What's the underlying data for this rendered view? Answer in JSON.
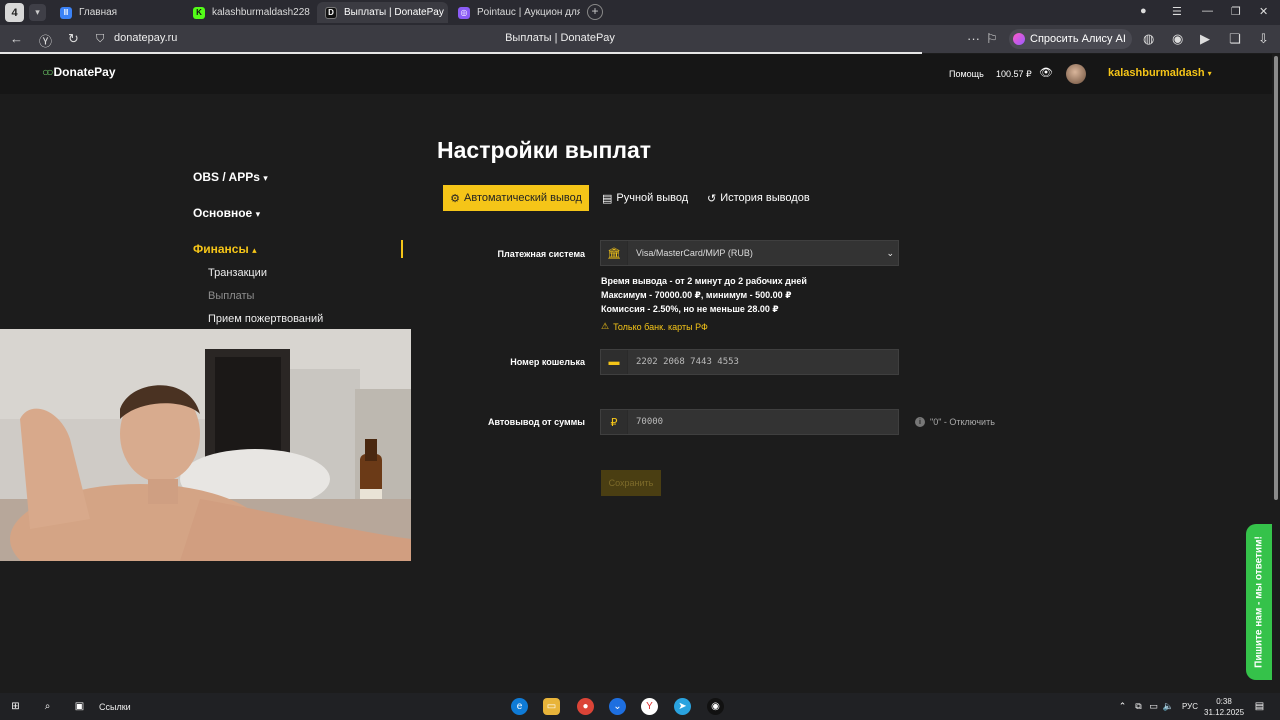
{
  "browser": {
    "tab_count": "4",
    "tabs": [
      {
        "title": "Главная",
        "favicon": "pause-icon",
        "color": "#3b82f6",
        "glyph": "II"
      },
      {
        "title": "kalashburmaldash228 Stre",
        "favicon": "kick-icon",
        "color": "#53fc18",
        "glyph": "K"
      },
      {
        "title": "Выплаты | DonatePay",
        "favicon": "donatepay-icon",
        "color": "#2b2b2b",
        "glyph": "D:"
      },
      {
        "title": "Pointauc | Аукцион для ст",
        "favicon": "pointauc-icon",
        "color": "#8b5cf6",
        "glyph": "◎"
      }
    ],
    "url": "donatepay.ru",
    "page_title": "Выплаты | DonatePay",
    "alice_label": "Спросить Алису AI"
  },
  "site": {
    "logo": "DonatePay",
    "help": "Помощь",
    "balance": "100.57 ₽",
    "username": "kalashburmaldash"
  },
  "sidebar": {
    "sections": [
      {
        "label": "OBS / APPs",
        "arrow": "▾"
      },
      {
        "label": "Основное",
        "arrow": "▾"
      },
      {
        "label": "Финансы",
        "arrow": "▴"
      }
    ],
    "finance_items": [
      {
        "label": "Транзакции"
      },
      {
        "label": "Выплаты"
      },
      {
        "label": "Прием пожертвований"
      }
    ]
  },
  "main": {
    "title": "Настройки выплат",
    "tabs": [
      {
        "label": "Автоматический вывод",
        "icon": "gear-icon"
      },
      {
        "label": "Ручной вывод",
        "icon": "database-icon"
      },
      {
        "label": "История выводов",
        "icon": "history-icon"
      }
    ],
    "payment_system": {
      "label": "Платежная система",
      "value": "Visa/MasterCard/МИР (RUB)"
    },
    "info_lines": [
      "Время вывода - от 2 минут до 2 рабочих дней",
      "Максимум  -  70000.00 ₽, минимум  -  500.00 ₽",
      "Комиссия  -  2.50%, но не меньше 28.00 ₽"
    ],
    "warning": "Только банк. карты РФ",
    "wallet": {
      "label": "Номер кошелька",
      "value": "2202 2068 7443 4553"
    },
    "auto_withdraw": {
      "label": "Автовывод от суммы",
      "value": "70000",
      "hint": "\"0\" - Отключить"
    },
    "save_label": "Сохранить"
  },
  "chat_widget": "Пишите нам - мы ответим!",
  "taskbar": {
    "links": "Ссылки",
    "lang": "РУС",
    "time": "0:38",
    "date": "31.12.2025"
  },
  "colors": {
    "accent": "#f5c518",
    "background": "#1c1c1c",
    "chat_green": "#35c24a"
  }
}
